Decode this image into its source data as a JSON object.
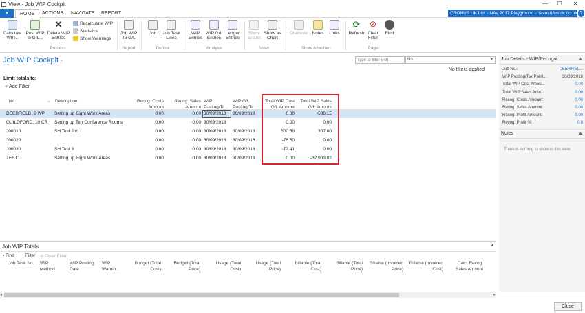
{
  "titlebar": {
    "title": "View - Job WIP Cockpit",
    "controls": [
      "—",
      "☐",
      "✕"
    ]
  },
  "tabs": {
    "app_menu": "▾",
    "items": [
      "HOME",
      "ACTIONS",
      "NAVIGATE",
      "REPORT"
    ],
    "active": "HOME",
    "company": "CRONUS UK Ltd. - NAV 2017 Playground - navmt03vs.dc.co.uk",
    "help": "?"
  },
  "ribbon": {
    "groups": [
      {
        "label": "Process",
        "buttons": [
          "Calculate WIP...",
          "Post WIP to G/L...",
          "Delete WIP Entries"
        ],
        "small": [
          "Recalculate WIP",
          "Statistics",
          "Show Warnings"
        ]
      },
      {
        "label": "Report",
        "buttons": [
          "Job WIP To G/L"
        ]
      },
      {
        "label": "Define",
        "buttons": [
          "Job",
          "Job Task Lines"
        ]
      },
      {
        "label": "Analyse",
        "buttons": [
          "WIP Entries",
          "WIP G/L Entries",
          "Ledger Entries"
        ]
      },
      {
        "label": "View",
        "buttons": [
          "Show as List",
          "Show as Chart"
        ]
      },
      {
        "label": "Show Attached",
        "buttons": [
          "OneNote",
          "Notes",
          "Links"
        ]
      },
      {
        "label": "Page",
        "buttons": [
          "Refresh",
          "Clear Filter",
          "Find"
        ]
      }
    ]
  },
  "page": {
    "title": "Job WIP Cockpit",
    "title_caret": "·",
    "filter_placeholder": "Type to filter (F3)",
    "filter_field": "No.",
    "no_filters": "No filters applied",
    "limit_totals": "Limit totals to:",
    "add_filter": "Add Filter"
  },
  "table": {
    "headers": [
      "No.",
      "Description",
      "Recog. Costs Amount",
      "Recog. Sales Amount",
      "WIP Posting/Ta...",
      "WIP G/L Posting/Ta...",
      "Total WIP Cost G/L Amount",
      "Total WIP Sales G/L Amount"
    ],
    "rows": [
      {
        "no": "DEERFIELD, 8 WP",
        "desc": "Setting up Eight Work Areas",
        "costs": "0.00",
        "sales": "0.00",
        "wip_date": "30/09/2018",
        "gl_date": "30/09/2018",
        "tot_cost": "0.00",
        "tot_sales": "-536.15"
      },
      {
        "no": "GUILDFORD, 10 CR",
        "desc": "Setting up Ten Conference Rooms",
        "costs": "0.00",
        "sales": "0.00",
        "wip_date": "30/09/2018",
        "gl_date": "",
        "tot_cost": "0.00",
        "tot_sales": "0.00"
      },
      {
        "no": "J00010",
        "desc": "SH Test Job",
        "costs": "0.00",
        "sales": "0.00",
        "wip_date": "30/09/2018",
        "gl_date": "30/09/2018",
        "tot_cost": "500.59",
        "tot_sales": "307.00"
      },
      {
        "no": "J00020",
        "desc": "",
        "costs": "0.00",
        "sales": "0.00",
        "wip_date": "30/09/2018",
        "gl_date": "30/09/2018",
        "tot_cost": "-78.50",
        "tot_sales": "0.00"
      },
      {
        "no": "J00030",
        "desc": "SH Test 3",
        "costs": "0.00",
        "sales": "0.00",
        "wip_date": "30/09/2018",
        "gl_date": "30/09/2018",
        "tot_cost": "-72.41",
        "tot_sales": "0.00"
      },
      {
        "no": "TEST1",
        "desc": "Setting up Eight Work Areas",
        "costs": "0.00",
        "sales": "0.00",
        "wip_date": "30/09/2018",
        "gl_date": "30/09/2018",
        "tot_cost": "0.00",
        "tot_sales": "-32,903.02"
      }
    ]
  },
  "wip_totals": {
    "title": "Job WIP Totals",
    "find": "Find",
    "filter": "Filter",
    "clear_filter": "Clear Filter",
    "headers": [
      "Job Task No.",
      "WIP Method",
      "WIP Posting Date",
      "WIP Warnin...",
      "Budget (Total Cost)",
      "Budget (Total Price)",
      "Usage (Total Cost)",
      "Usage (Total Price)",
      "Billable (Total Cost)",
      "Billable (Total Price)",
      "Billable (Invoiced Price)",
      "Billable (Invoiced Cost)",
      "Calc. Recog. Sales Amount"
    ]
  },
  "factbox": {
    "title": "Job Details - WIP/Recogni...",
    "fields": [
      {
        "label": "Job No.:",
        "value": "DEERFIEL..."
      },
      {
        "label": "WIP Posting/Tax Point...",
        "value": "30/09/2018"
      },
      {
        "label": "Total WIP Cost Amou...",
        "value": "0.00"
      },
      {
        "label": "Total WIP Sales Amo...",
        "value": "0.00"
      },
      {
        "label": "Recog. Costs Amount:",
        "value": "0.00"
      },
      {
        "label": "Recog. Sales Amount:",
        "value": "0.00"
      },
      {
        "label": "Recog. Profit Amount:",
        "value": "0.00"
      },
      {
        "label": "Recog. Profit %:",
        "value": "0.0"
      }
    ],
    "notes_title": "Notes",
    "notes_empty": "There is nothing to show in this view."
  },
  "footer": {
    "close": "Close"
  },
  "colors": {
    "accent": "#1e6fc8",
    "highlight": "#d9262e",
    "selected_row": "#d5e5f6"
  }
}
